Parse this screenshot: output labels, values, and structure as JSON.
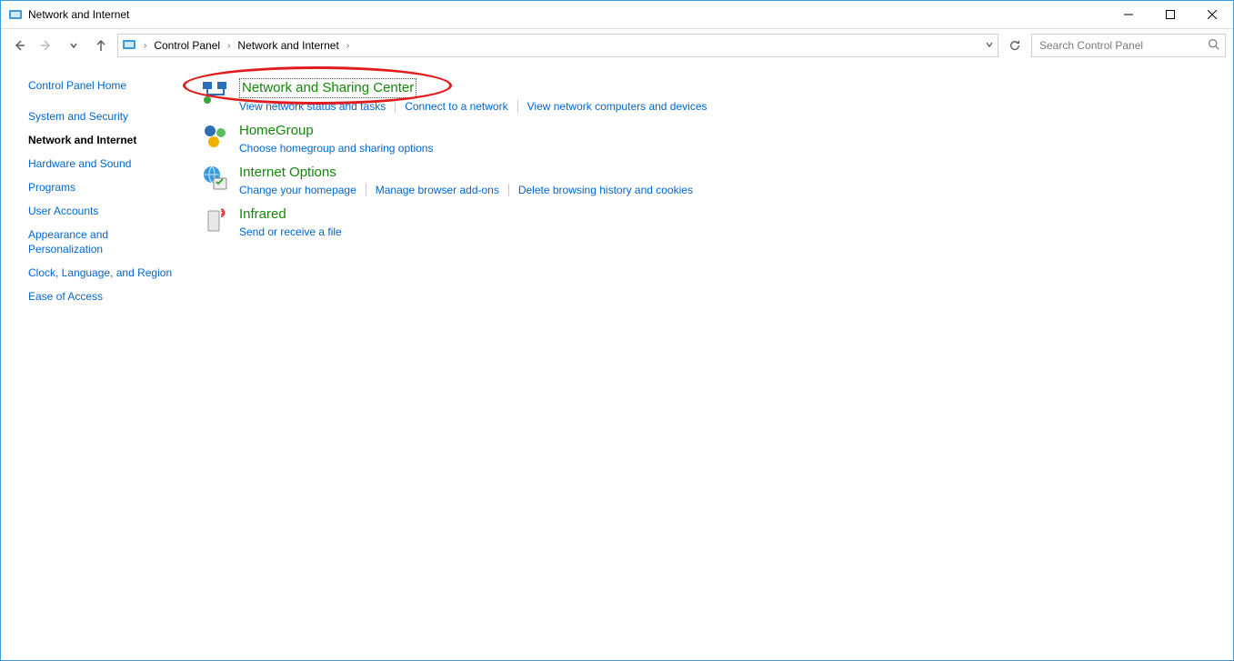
{
  "window": {
    "title": "Network and Internet"
  },
  "breadcrumbs": {
    "root_icon": "control-panel-icon",
    "items": [
      "Control Panel",
      "Network and Internet"
    ]
  },
  "search": {
    "placeholder": "Search Control Panel"
  },
  "sidebar": {
    "items": [
      {
        "label": "Control Panel Home",
        "active": false
      },
      {
        "label": "System and Security",
        "active": false
      },
      {
        "label": "Network and Internet",
        "active": true
      },
      {
        "label": "Hardware and Sound",
        "active": false
      },
      {
        "label": "Programs",
        "active": false
      },
      {
        "label": "User Accounts",
        "active": false
      },
      {
        "label": "Appearance and Personalization",
        "active": false
      },
      {
        "label": "Clock, Language, and Region",
        "active": false
      },
      {
        "label": "Ease of Access",
        "active": false
      }
    ]
  },
  "categories": [
    {
      "icon": "network-sharing-icon",
      "title": "Network and Sharing Center",
      "focused": true,
      "annotated": true,
      "tasks": [
        "View network status and tasks",
        "Connect to a network",
        "View network computers and devices"
      ]
    },
    {
      "icon": "homegroup-icon",
      "title": "HomeGroup",
      "tasks": [
        "Choose homegroup and sharing options"
      ]
    },
    {
      "icon": "internet-options-icon",
      "title": "Internet Options",
      "tasks": [
        "Change your homepage",
        "Manage browser add-ons",
        "Delete browsing history and cookies"
      ]
    },
    {
      "icon": "infrared-icon",
      "title": "Infrared",
      "tasks": [
        "Send or receive a file"
      ]
    }
  ]
}
